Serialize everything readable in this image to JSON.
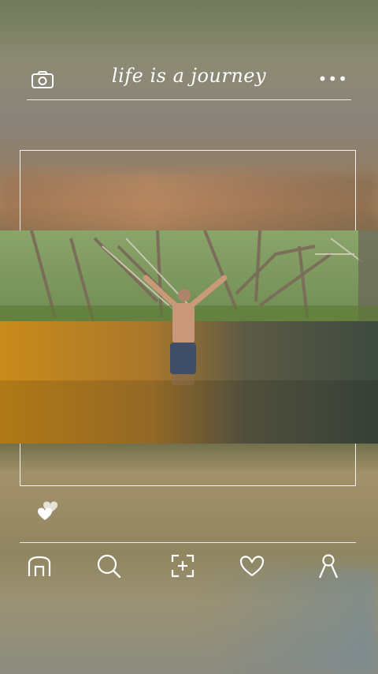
{
  "header": {
    "title": "life is a journey",
    "camera_icon": "camera-icon",
    "more_label": "•••"
  },
  "post": {
    "image_alt": "man standing in river in forest",
    "like_icon": "heart-icon"
  },
  "navbar": {
    "items": [
      {
        "icon": "home-icon"
      },
      {
        "icon": "search-icon"
      },
      {
        "icon": "add-post-icon"
      },
      {
        "icon": "heart-icon"
      },
      {
        "icon": "profile-icon"
      }
    ]
  },
  "colors": {
    "line": "#ffffff",
    "water": "#b97f1e",
    "foliage": "#5f7a3a"
  }
}
